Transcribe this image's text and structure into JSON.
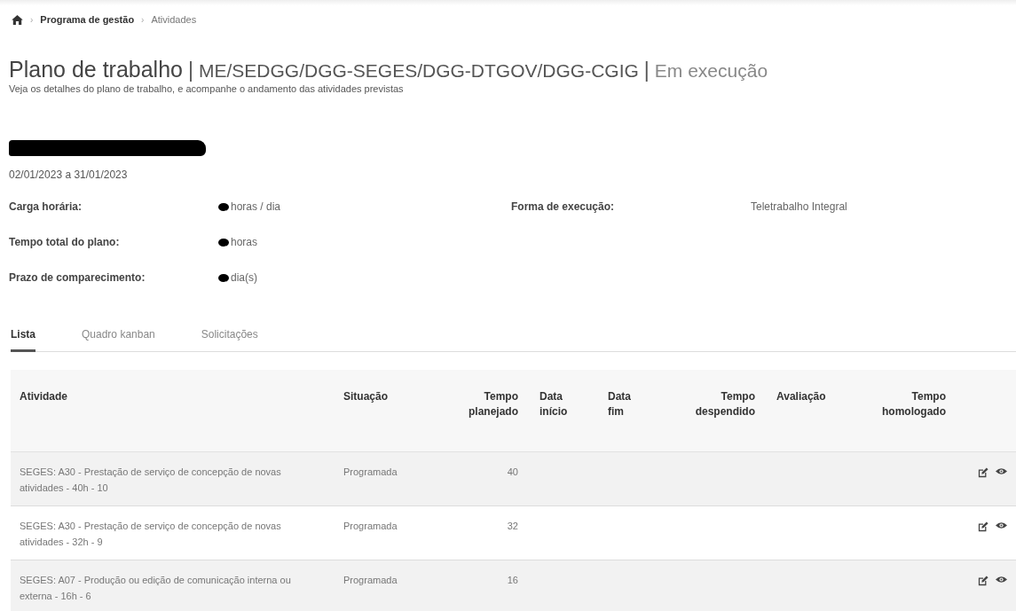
{
  "breadcrumb": {
    "separator": "›",
    "items": [
      {
        "label": "Programa de gestão",
        "current": false
      },
      {
        "label": "Atividades",
        "current": true
      }
    ]
  },
  "header": {
    "title": "Plano de trabalho",
    "divider": "|",
    "unit": "ME/SEDGG/DGG-SEGES/DGG-DTGOV/DGG-CGIG",
    "status": "Em execução",
    "subtitle": "Veja os detalhes do plano de trabalho, e acompanhe o andamento das atividades previstas"
  },
  "plan": {
    "period": "02/01/2023 a 31/01/2023",
    "fields": [
      {
        "label": "Carga horária:",
        "value": "horas / dia",
        "redacted": true
      },
      {
        "label": "Tempo total do plano:",
        "value": "horas",
        "redacted": true
      },
      {
        "label": "Prazo de comparecimento:",
        "value": "dia(s)",
        "redacted": true
      }
    ],
    "side_fields": [
      {
        "label": "Forma de execução:",
        "value": "Teletrabalho Integral"
      }
    ]
  },
  "tabs": [
    {
      "label": "Lista",
      "selected": true
    },
    {
      "label": "Quadro kanban",
      "selected": false
    },
    {
      "label": "Solicitações",
      "selected": false
    }
  ],
  "table": {
    "columns": [
      [
        "Atividade"
      ],
      [
        "Situação"
      ],
      [
        "Tempo",
        "planejado"
      ],
      [
        "Data",
        "início"
      ],
      [
        "Data",
        "fim"
      ],
      [
        "Tempo",
        "despendido"
      ],
      [
        "Avaliação"
      ],
      [
        "Tempo",
        "homologado"
      ]
    ],
    "rows": [
      {
        "activity": "SEGES: A30 - Prestação de serviço de concepção de novas atividades - 40h - 10",
        "status": "Programada",
        "planned": "40"
      },
      {
        "activity": "SEGES: A30 - Prestação de serviço de concepção de novas atividades - 32h - 9",
        "status": "Programada",
        "planned": "32"
      },
      {
        "activity": "SEGES: A07 - Produção ou edição de comunicação interna ou externa - 16h - 6",
        "status": "Programada",
        "planned": "16"
      }
    ]
  }
}
